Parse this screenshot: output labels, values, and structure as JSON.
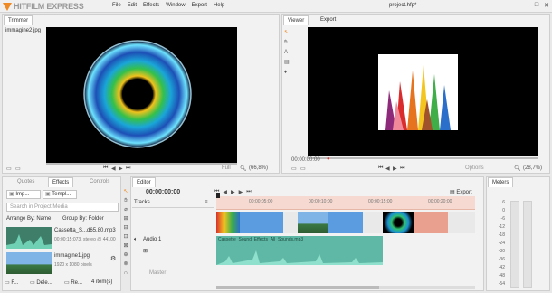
{
  "app": {
    "logo": "HITFILM EXPRESS",
    "menu": [
      "File",
      "Edit",
      "Effects",
      "Window",
      "Export",
      "Help"
    ],
    "project_title": "project.hfp*",
    "colors": {
      "accent": "#f08a24",
      "timeline_ruler": "#f6d9d0",
      "video_blue": "#5b9ce0",
      "video_salmon": "#e9a08f",
      "audio_green": "#5fb8a5"
    }
  },
  "trimmer": {
    "tab": "Trimmer",
    "file": "immagine2.jpg",
    "zoom": "(66,8%)",
    "full_label": "Full"
  },
  "viewer": {
    "tabs": [
      "Viewer",
      "Export"
    ],
    "timecode": "00:00:00:00",
    "options_label": "Options",
    "zoom": "(28,7%)"
  },
  "media": {
    "tabs": [
      "Quotes",
      "Effects",
      "Controls"
    ],
    "import_label": "Imp...",
    "template_label": "Templ...",
    "search_placeholder": "Search in Project Media",
    "arrange_label": "Arrange By: Name",
    "group_label": "Group By: Folder",
    "items": [
      {
        "name": "Cassetta_S...d65,80.mp3",
        "info": "00:00:15;073, stereo @ 44100"
      },
      {
        "name": "immagine1.jpg",
        "info": "1920 x 1080 pixels"
      }
    ],
    "bottom": {
      "folder_label": "F...",
      "delete_label": "Dele...",
      "remove_label": "Re...",
      "count": "4 item(s)"
    }
  },
  "editor": {
    "tab": "Editor",
    "timecode": "00:00:00:00",
    "export_label": "Export",
    "tracks_label": "Tracks",
    "audio_track": "Audio 1",
    "master_label": "Master",
    "ruler_marks": [
      "00:00:05:00",
      "00:00:10:00",
      "00:00:15:00",
      "00:00:20:00"
    ],
    "audio_clip": "Cassette_Sound_Effects_All_Sounds.mp3"
  },
  "meters": {
    "tab": "Meters",
    "scale": [
      "6",
      "0",
      "-6",
      "-12",
      "-18",
      "-24",
      "-30",
      "-36",
      "-42",
      "-48",
      "-54"
    ]
  }
}
